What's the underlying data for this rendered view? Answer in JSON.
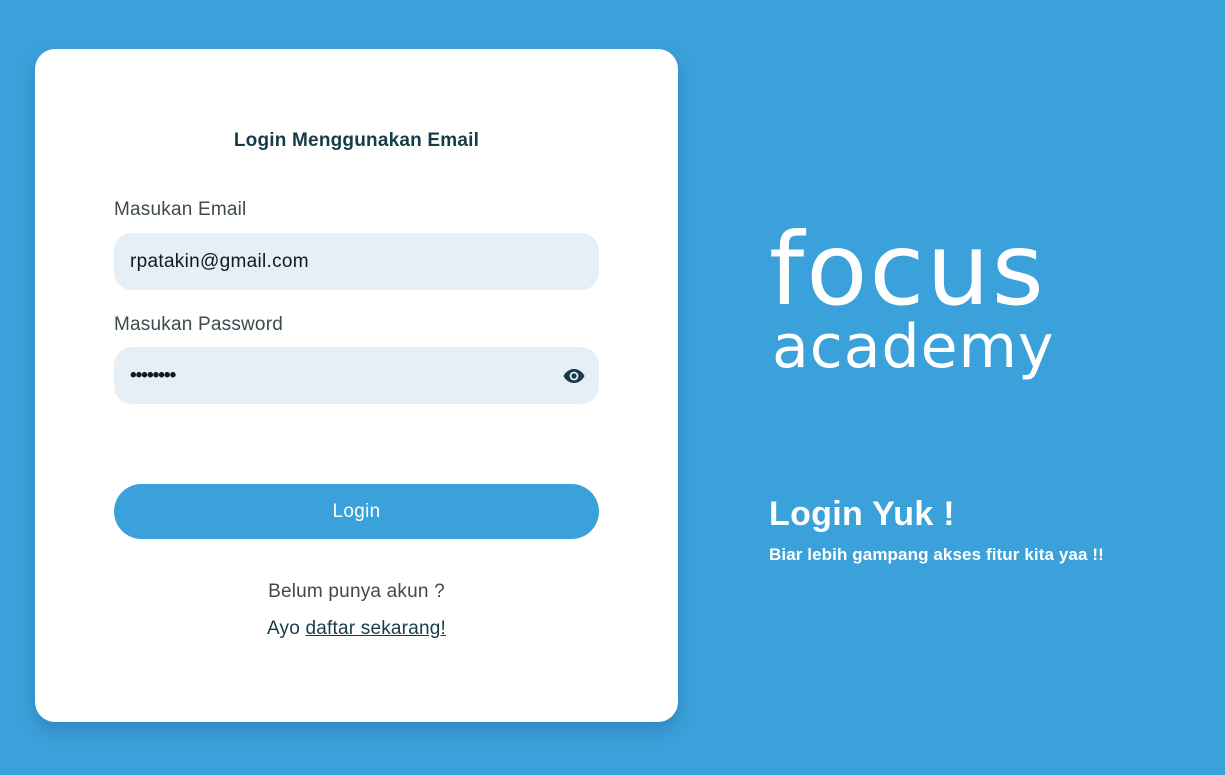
{
  "theme": {
    "background": "#3ba1db",
    "card": "#ffffff",
    "input_background": "#e6eef6",
    "primary_button": "#3ba1db",
    "dark_text": "#163c48"
  },
  "login_form": {
    "title": "Login Menggunakan Email",
    "email_label": "Masukan Email",
    "email_value": "rpatakin@gmail.com",
    "password_label": "Masukan Password",
    "password_value": "••••••••",
    "password_visibility_icon": "eye-icon",
    "login_button": "Login",
    "signup_question": "Belum punya akun ?",
    "signup_prefix": "Ayo ",
    "signup_link": "daftar sekarang!"
  },
  "brand": {
    "logo_line1": "focus",
    "logo_line2": "academy"
  },
  "promo": {
    "title": "Login Yuk !",
    "subtitle": "Biar lebih gampang akses fitur kita yaa !!"
  }
}
